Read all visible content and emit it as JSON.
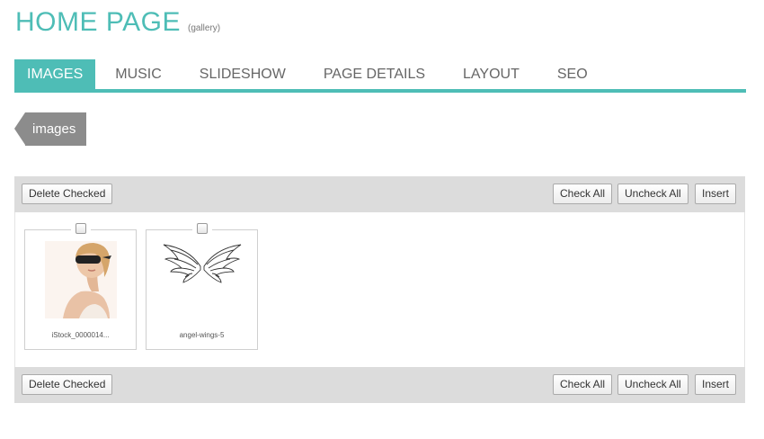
{
  "header": {
    "title": "HOME PAGE",
    "subtitle": "(gallery)"
  },
  "tabs": [
    {
      "label": "IMAGES",
      "active": true
    },
    {
      "label": "MUSIC"
    },
    {
      "label": "SLIDESHOW"
    },
    {
      "label": "PAGE DETAILS"
    },
    {
      "label": "LAYOUT"
    },
    {
      "label": "SEO"
    }
  ],
  "section_tag": "images",
  "toolbar": {
    "delete_label": "Delete Checked",
    "check_all_label": "Check All",
    "uncheck_all_label": "Uncheck All",
    "insert_label": "Insert"
  },
  "images": [
    {
      "caption": "iStock_0000014...",
      "checked": false,
      "icon": "woman-portrait-photo"
    },
    {
      "caption": "angel-wings-5",
      "checked": false,
      "icon": "angel-wings-drawing"
    }
  ],
  "colors": {
    "accent": "#4ebdb6",
    "tag": "#8c8c8c",
    "toolbar": "#dcdcdc"
  }
}
